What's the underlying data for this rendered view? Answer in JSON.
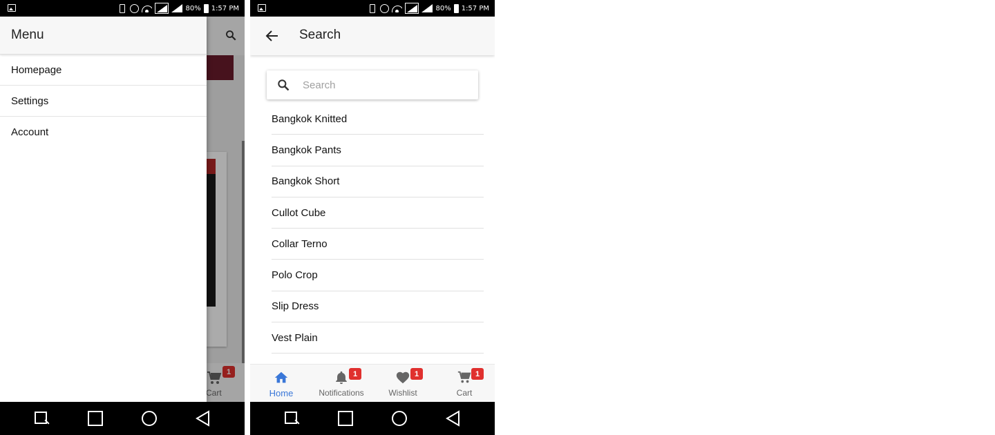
{
  "status_bar": {
    "battery": "80%",
    "time": "1:57 PM"
  },
  "left_screen": {
    "drawer": {
      "title": "Menu",
      "items": [
        {
          "label": "Homepage"
        },
        {
          "label": "Settings"
        },
        {
          "label": "Account"
        }
      ]
    },
    "background": {
      "cart_label": "Cart",
      "cart_badge": "1"
    }
  },
  "right_screen": {
    "title": "Search",
    "search": {
      "placeholder": "Search",
      "value": ""
    },
    "results": [
      {
        "label": "Bangkok Knitted"
      },
      {
        "label": "Bangkok Pants"
      },
      {
        "label": "Bangkok Short"
      },
      {
        "label": "Cullot Cube"
      },
      {
        "label": "Collar Terno"
      },
      {
        "label": "Polo Crop"
      },
      {
        "label": "Slip Dress"
      },
      {
        "label": "Vest Plain"
      }
    ],
    "bottom_nav": {
      "home": {
        "label": "Home",
        "icon": "home-icon"
      },
      "notifications": {
        "label": "Notifications",
        "icon": "bell-icon",
        "badge": "1"
      },
      "wishlist": {
        "label": "Wishlist",
        "icon": "heart-icon",
        "badge": "1"
      },
      "cart": {
        "label": "Cart",
        "icon": "cart-icon",
        "badge": "1"
      }
    }
  },
  "colors": {
    "accent": "#3a77d8",
    "badge": "#e0302e",
    "appbar": "#f7f7f7"
  }
}
